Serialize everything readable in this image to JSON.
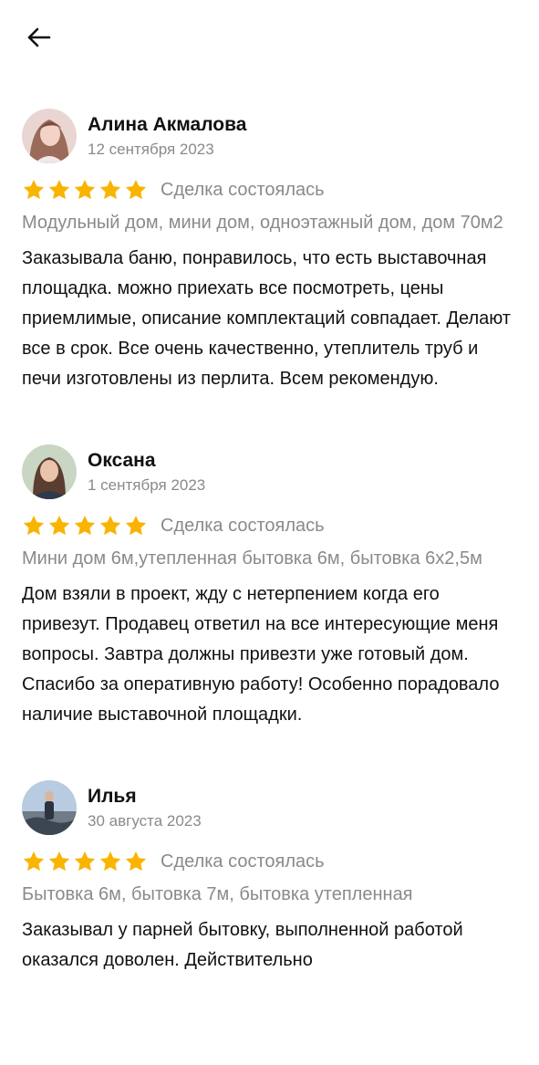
{
  "header": {
    "back_icon": "arrow-left-icon"
  },
  "colors": {
    "star": "#F8B400",
    "muted_text": "#8A8A8A",
    "text": "#111111"
  },
  "reviews": [
    {
      "name": "Алина Акмалова",
      "date": "12 сентября 2023",
      "rating": 5,
      "deal_status": "Сделка состоялась",
      "product": "Модульный дом, мини дом, одноэтажный дом, дом 70м2",
      "text": "Заказывала баню, понравилось, что есть выставочная площадка. можно приехать все посмотреть, цены приемлимые, описание комплектаций совпадает. Делают все в срок. Все очень качественно, утеплитель труб и печи изготовлены из перлита. Всем рекомендую."
    },
    {
      "name": "Оксана",
      "date": "1 сентября 2023",
      "rating": 5,
      "deal_status": "Сделка состоялась",
      "product": "Мини дом 6м,утепленная бытовка 6м, бытовка 6x2,5м",
      "text": "Дом взяли в проект, жду с нетерпением когда его привезут. Продавец ответил на все интересующие меня вопросы. Завтра должны привезти уже готовый дом. Спасибо за оперативную работу! Особенно порадовало наличие выставочной площадки."
    },
    {
      "name": "Илья",
      "date": "30 августа 2023",
      "rating": 5,
      "deal_status": "Сделка состоялась",
      "product": "Бытовка 6м, бытовка 7м, бытовка утепленная",
      "text": "Заказывал у парней бытовку, выполненной работой оказался доволен. Действительно"
    }
  ]
}
